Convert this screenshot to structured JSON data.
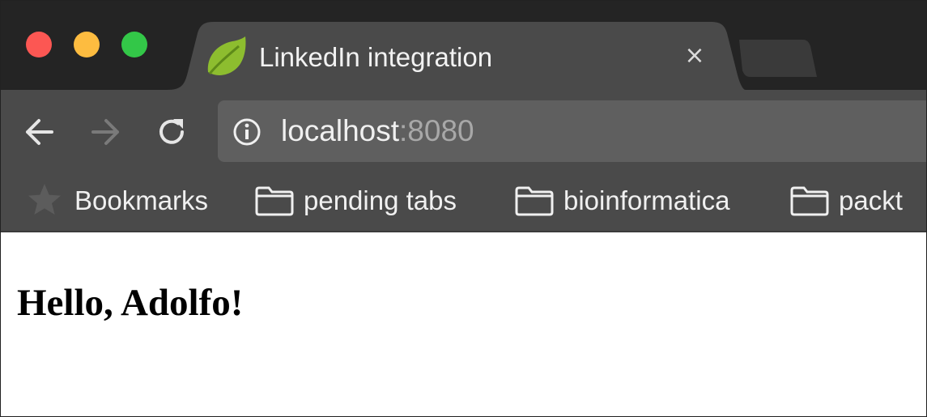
{
  "window": {
    "traffic_lights": {
      "close": "#fc5753",
      "minimize": "#fdbc40",
      "zoom": "#33c748"
    }
  },
  "tab": {
    "title": "LinkedIn integration",
    "favicon": "spring-leaf-icon",
    "close_label": "×"
  },
  "toolbar": {
    "back_icon": "arrow-left-icon",
    "forward_icon": "arrow-right-icon",
    "reload_icon": "reload-icon",
    "address": {
      "info_icon": "info-icon",
      "host": "localhost",
      "port": ":8080"
    }
  },
  "bookmarks": {
    "star_icon": "star-icon",
    "label": "Bookmarks",
    "folders": [
      {
        "label": "pending tabs",
        "icon": "folder-icon"
      },
      {
        "label": "bioinformatica",
        "icon": "folder-icon"
      },
      {
        "label": "packt",
        "icon": "folder-icon"
      }
    ]
  },
  "page": {
    "heading": "Hello, Adolfo!"
  },
  "colors": {
    "tabstrip": "#242424",
    "active_tab": "#4a4a4a",
    "toolbar": "#4a4a4a",
    "omnibox": "#5f5f5f"
  }
}
